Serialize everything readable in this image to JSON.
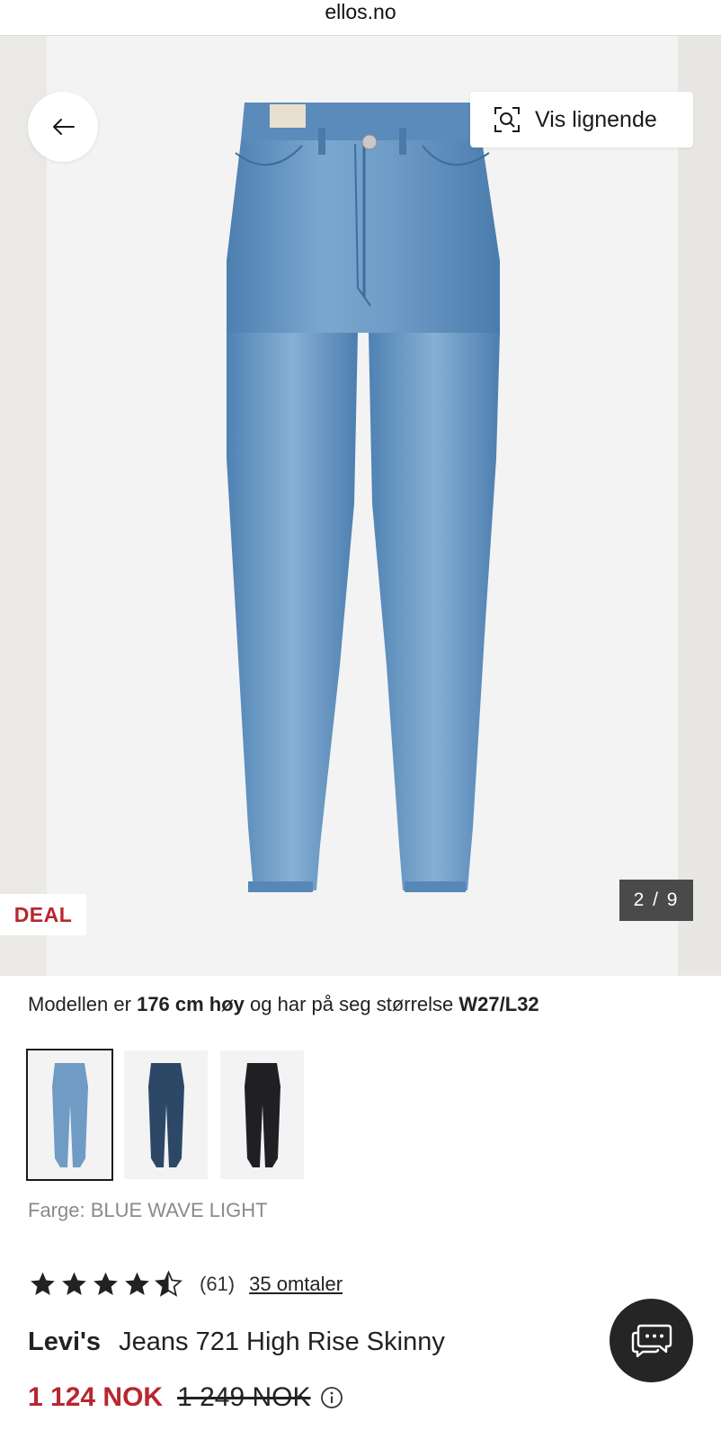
{
  "browser": {
    "url": "ellos.no"
  },
  "gallery": {
    "similar_label": "Vis lignende",
    "badge": "DEAL",
    "counter": "2 / 9"
  },
  "model_info": {
    "prefix": "Modellen er",
    "height": "176 cm høy",
    "middle": "og har på seg størrelse",
    "size": "W27/L32"
  },
  "variants": [
    {
      "name": "BLUE WAVE LIGHT",
      "color": "#6f9bc4",
      "selected": true
    },
    {
      "name": "dark-blue",
      "color": "#2c4866",
      "selected": false
    },
    {
      "name": "black",
      "color": "#1f1f24",
      "selected": false
    }
  ],
  "color": {
    "label": "Farge: BLUE WAVE LIGHT"
  },
  "rating": {
    "value": 4.5,
    "max": 5,
    "count": "(61)",
    "reviews_link": "35 omtaler"
  },
  "product": {
    "brand": "Levi's",
    "name": "Jeans 721 High Rise Skinny"
  },
  "price": {
    "current": "1 124 NOK",
    "original": "1 249 NOK",
    "accent_color": "#b7272f"
  },
  "icons": {
    "back": "arrow-left-icon",
    "similar": "visual-search-icon",
    "info": "info-icon",
    "chat": "chat-bubbles-icon"
  }
}
